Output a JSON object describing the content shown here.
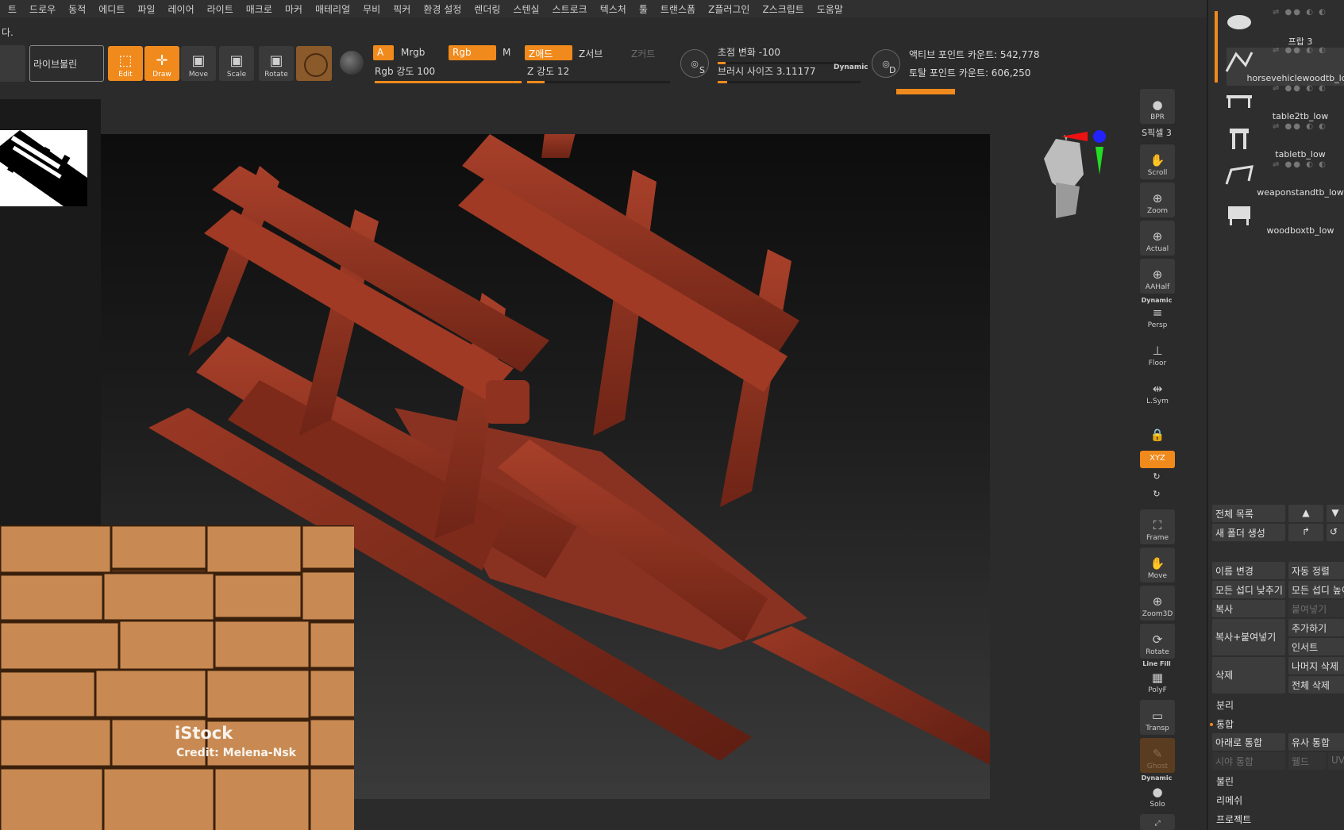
{
  "menu": [
    "트",
    "드로우",
    "동적",
    "에디트",
    "파일",
    "레이어",
    "라이트",
    "매크로",
    "마커",
    "매테리얼",
    "무비",
    "픽커",
    "환경 설정",
    "렌더링",
    "스텐실",
    "스트로크",
    "텍스처",
    "툴",
    "트랜스폼",
    "Z플러그인",
    "Z스크립트",
    "도움말"
  ],
  "status_text": "다.",
  "toolbar": {
    "live_boolean": "라이브불린",
    "edit": "Edit",
    "draw": "Draw",
    "move": "Move",
    "scale": "Scale",
    "rotate": "Rotate",
    "a_label": "A",
    "mrgb": "Mrgb",
    "rgb": "Rgb",
    "m": "M",
    "zadd": "Z애드",
    "zsub": "Z서브",
    "zcut": "Z커트",
    "rgb_intensity": "Rgb 강도 100",
    "z_intensity": "Z 강도 12",
    "focal_shift": "초점 변화 -100",
    "brush_size": "브러시 사이즈 3.11177",
    "dynamic": "Dynamic",
    "s_label": "S",
    "d_label": "D",
    "active_points": "액티브 포인트 카운트: 542,778",
    "total_points": "토탈 포인트 카운트: 606,250"
  },
  "slider_levels": {
    "rgb_intensity": 1.0,
    "z_intensity": 0.12,
    "focal_shift": 0.0,
    "brush_size": 0.05
  },
  "photo": {
    "brand": "iStock",
    "credit": "Credit: Melena-Nsk"
  },
  "vertical_tools": {
    "bpr": "BPR",
    "spix": "S픽셀 3",
    "scroll": "Scroll",
    "zoom": "Zoom",
    "actual": "Actual",
    "aahalf": "AAHalf",
    "dynamic": "Dynamic",
    "persp": "Persp",
    "floor": "Floor",
    "lsym": "L.Sym",
    "xyz": "XYZ",
    "frame": "Frame",
    "move": "Move",
    "zoom3d": "Zoom3D",
    "rotate": "Rotate",
    "linefill": "Line Fill",
    "polyf": "PolyF",
    "transp": "Transp",
    "ghost": "Ghost",
    "dynamic2": "Dynamic",
    "solo": "Solo"
  },
  "subtools": [
    "프랍 3",
    "horsevehiclewoodtb_low",
    "table2tb_low",
    "tabletb_low",
    "weaponstandtb_low",
    "woodboxtb_low"
  ],
  "panel": {
    "all_list": "전체 목록",
    "new_folder": "새 폴더 생성",
    "rename": "이름 변경",
    "auto_sort": "자동 정렬",
    "lower_all": "모든 섭디 낮추기",
    "higher_all": "모든 섭디 높이",
    "copy": "복사",
    "paste": "붙여넣기",
    "copy_paste": "복사+붙여넣기",
    "add": "추가하기",
    "insert": "인서트",
    "delete": "삭제",
    "delete_rest": "나머지 삭제",
    "delete_all": "전체 삭제",
    "split": "분리",
    "merge": "통합",
    "merge_down": "아래로 통합",
    "merge_similar": "유사 통합",
    "merge_visible": "시야 통합",
    "weld": "웰드",
    "uv": "UV",
    "boolean": "불린",
    "remesh": "리메쉬",
    "project": "프로젝트"
  },
  "colors": {
    "accent": "#f08a1c",
    "wood": "#8b3020"
  }
}
